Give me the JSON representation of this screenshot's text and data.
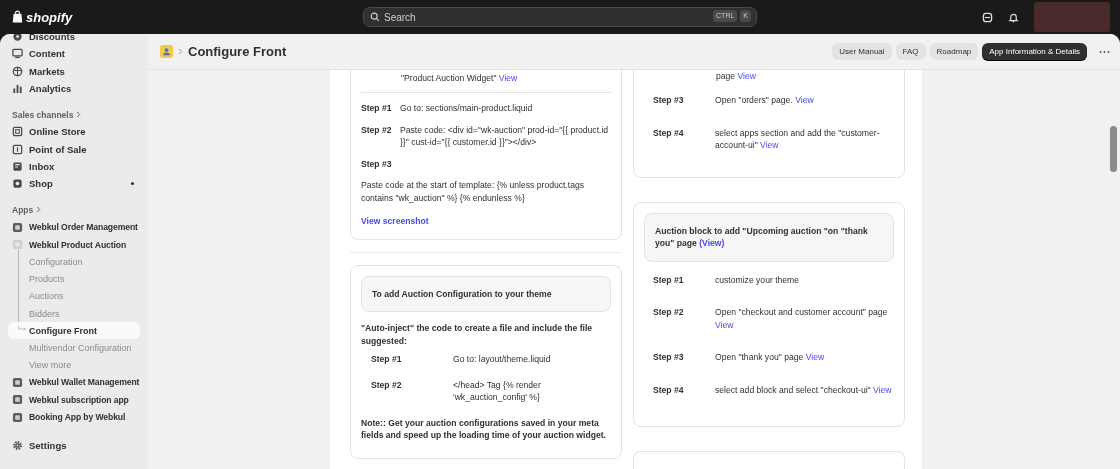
{
  "topbar": {
    "logo": "shopify",
    "search": {
      "placeholder": "Search",
      "keys": [
        "CTRL",
        "K"
      ]
    }
  },
  "sidebar": {
    "nav": [
      {
        "label": "Discounts"
      },
      {
        "label": "Content"
      },
      {
        "label": "Markets"
      },
      {
        "label": "Analytics"
      }
    ],
    "sales_channels": {
      "heading": "Sales channels",
      "items": [
        {
          "label": "Online Store",
          "unread": false
        },
        {
          "label": "Point of Sale",
          "unread": false
        },
        {
          "label": "Inbox",
          "unread": false
        },
        {
          "label": "Shop",
          "unread": true
        }
      ]
    },
    "apps": {
      "heading": "Apps",
      "items": [
        {
          "label": "Webkul Order Management",
          "expanded": false
        },
        {
          "label": "Webkul Product Auction",
          "expanded": true,
          "children": [
            {
              "label": "Configuration",
              "selected": false
            },
            {
              "label": "Products",
              "selected": false
            },
            {
              "label": "Auctions",
              "selected": false
            },
            {
              "label": "Bidders",
              "selected": false
            },
            {
              "label": "Configure Front",
              "selected": true
            },
            {
              "label": "Multivendor Configuration",
              "selected": false
            },
            {
              "label": "View more",
              "selected": false
            }
          ]
        },
        {
          "label": "Webkul Wallet Management",
          "expanded": false
        },
        {
          "label": "Webkul subscription app",
          "expanded": false
        },
        {
          "label": "Booking App by Webkul",
          "expanded": false
        }
      ]
    },
    "settings": "Settings"
  },
  "header": {
    "title": "Configure Front",
    "buttons": [
      {
        "label": "User Manual",
        "kind": "secondary"
      },
      {
        "label": "FAQ",
        "kind": "secondary"
      },
      {
        "label": "Roadmap",
        "kind": "secondary"
      },
      {
        "label": "App Information & Details",
        "kind": "primary"
      }
    ]
  },
  "columns": [
    [
      {
        "cut_top": true,
        "kind": "compact",
        "blocks": [
          {
            "kind": "tail",
            "text": "\"Product Auction Widget\"",
            "link": "View"
          },
          {
            "kind": "step",
            "label": "Step #1",
            "text": "Go to: sections/main-product.liquid"
          },
          {
            "kind": "step",
            "label": "Step #2",
            "text": "Paste code: <div id=\"wk-auction\" prod-id=\"{{ product.id }}\" cust-id=\"{{ customer.id }}\"></div>"
          },
          {
            "kind": "step",
            "label": "Step #3"
          },
          {
            "kind": "text",
            "text": "Paste code at the start of template: {% unless product.tags contains \"wk_auction\" %} {% endunless %}"
          },
          {
            "kind": "link",
            "text": "View screenshot"
          }
        ]
      },
      {
        "cut_top": false,
        "kind": "indented",
        "heading": "To add Auction Configuration to your theme",
        "blocks": [
          {
            "kind": "lead",
            "text": "\"Auto-inject\" the code to create a file and include the file suggested:"
          },
          {
            "kind": "step",
            "label": "Step #1",
            "text": "Go to: layout/theme.liquid"
          },
          {
            "kind": "step",
            "label": "Step #2",
            "text": "</head> Tag {% render 'wk_auction_config' %}"
          },
          {
            "kind": "lead",
            "text": "Note:: Get your auction configurations saved in your meta fields and speed up the loading time of your auction widget."
          }
        ]
      }
    ],
    [
      {
        "cut_top": true,
        "kind": "wide",
        "blocks": [
          {
            "kind": "tail",
            "text": "page",
            "link": "View"
          },
          {
            "kind": "step",
            "label": "Step #3",
            "text": "Open \"orders\" page.",
            "link": "View"
          },
          {
            "kind": "step",
            "label": "Step #4",
            "text": "select apps section and add the \"customer-account-ui\"",
            "link": "View"
          }
        ]
      },
      {
        "cut_top": false,
        "kind": "wide",
        "heading": "Auction block to add \"Upcoming auction \"on \"thank you\" page",
        "heading_link": "(View)",
        "blocks": [
          {
            "kind": "step",
            "label": "Step #1",
            "text": "customize your theme"
          },
          {
            "kind": "step",
            "label": "Step #2",
            "text": "Open \"checkout and customer account\" page",
            "link": "View"
          },
          {
            "kind": "step",
            "label": "Step #3",
            "text": "Open \"thank you\" page",
            "link": "View"
          },
          {
            "kind": "step",
            "label": "Step #4",
            "text": "select add block and select \"checkout-ui\"",
            "link": "View"
          }
        ]
      }
    ]
  ]
}
